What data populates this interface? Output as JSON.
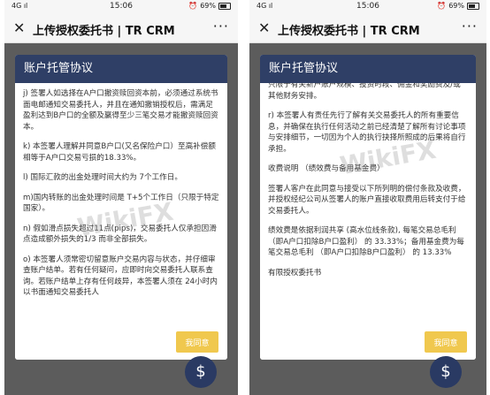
{
  "left": {
    "status": {
      "network": "4G ıl",
      "time": "15:06",
      "alarm": "⏰",
      "battery_pct": "69%"
    },
    "titlebar": {
      "close": "✕",
      "title": "上传授权委托书 | TR CRM",
      "more": "···"
    },
    "dialog": {
      "title": "账户托管协议",
      "paragraphs": [
        "j) 签署人如选择在A户口撤资赎回资本前，必须通过系统书面电邮通知交易委托人，并且在通知撤销授权后，需满足盈利达到B户口的全额及赢得至少三笔交易才能撤资赎回资本。",
        "k) 本签署人理解并同意B户口(又名保险户口）至高补偿额相等于A户口交易亏损的18.33%。",
        "l) 国际汇款的出金处理时间大约为 7个工作日。",
        "m)国内转账的出金处理时间是 T+5个工作日（只限于特定国家）。",
        "n) 假如滑点损失超过11点(pips)，交易委托人仅承担因滑点造成额外损失的1/3 而非全部损失。",
        "o) 本签署人须常密切留意账户交易内容与状态，并仔细审查账户结单。若有任何疑问，应即时向交易委托人联系查询。若账户结单上存有任何歧异，本签署人须在 24小时内以书面通知交易委托人"
      ],
      "agree_label": "我同意"
    },
    "fab": "$",
    "watermark": "WikiFX"
  },
  "right": {
    "status": {
      "network": "4G ıl",
      "time": "15:06",
      "alarm": "⏰",
      "battery_pct": "69%"
    },
    "titlebar": {
      "close": "✕",
      "title": "上传授权委托书 | TR CRM",
      "more": "···"
    },
    "dialog": {
      "title": "账户托管协议",
      "paragraphs": [
        "只限于有关新户账户规模、投资时段、佣金和奖励费及/或其他财务安排。",
        "r) 本签署人有责任先行了解有关交易委托人的所有重要信息，并确保在执行任何活动之前已经清楚了解所有讨论事项与安排细节，一切因为个人的执行抉择所照成的后果将自行承担。",
        "收费说明 （绩效费与备用基金费）",
        "签署人客户在此同意与接受以下所列明的偿付条款及收费，并授权经纪公司从签署人的账户直接收取费用后转支付于给交易委托人。",
        "绩效费是依据利润共享 (高水位线条款), 每笔交易总毛利 （即A户口扣除B户口盈利） 的 33.33%；备用基金费为每笔交易总毛利 （即A户口扣除B户口盈利） 的 13.33%",
        "有限授权委托书"
      ],
      "agree_label": "我同意"
    },
    "fab": "$",
    "watermark": "WikiFX"
  }
}
